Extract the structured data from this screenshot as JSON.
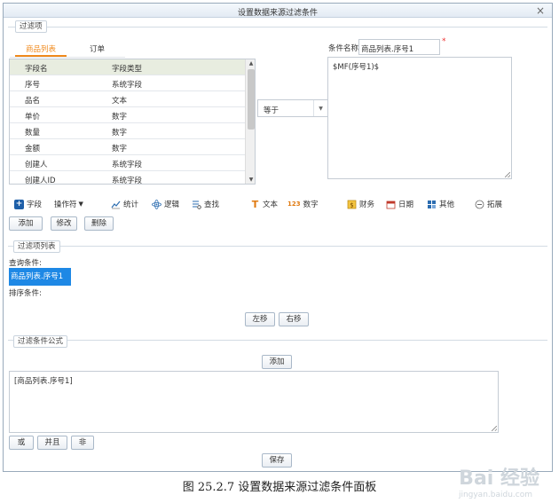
{
  "dialog": {
    "title": "设置数据来源过滤条件",
    "close_glyph": "×"
  },
  "filter_section": {
    "legend": "过滤项",
    "tabs": [
      {
        "label": "商品列表",
        "active": true
      },
      {
        "label": "订单",
        "active": false
      }
    ],
    "grid": {
      "columns": [
        "字段名",
        "字段类型"
      ],
      "rows": [
        [
          "序号",
          "系统字段"
        ],
        [
          "品名",
          "文本"
        ],
        [
          "单价",
          "数字"
        ],
        [
          "数量",
          "数字"
        ],
        [
          "金额",
          "数字"
        ],
        [
          "创建人",
          "系统字段"
        ],
        [
          "创建人ID",
          "系统字段"
        ]
      ]
    },
    "operator": {
      "selected": "等于"
    },
    "condition_name": {
      "label": "条件名称:",
      "value": "商品列表.序号1",
      "required_mark": "*"
    },
    "expression": "$MF(序号1)$"
  },
  "toolbar": {
    "items": [
      {
        "label": "字段",
        "icon": "plus-square-icon"
      },
      {
        "label": "操作符",
        "icon": "dropdown-caret-icon"
      },
      {
        "label": "统计",
        "icon": "line-chart-icon"
      },
      {
        "label": "逻辑",
        "icon": "atom-icon"
      },
      {
        "label": "查找",
        "icon": "list-search-icon"
      },
      {
        "label": "文本",
        "icon": "text-T-icon"
      },
      {
        "label": "数字",
        "icon": "number-123-icon"
      },
      {
        "label": "财务",
        "icon": "finance-icon"
      },
      {
        "label": "日期",
        "icon": "calendar-icon"
      },
      {
        "label": "其他",
        "icon": "grid-icon"
      },
      {
        "label": "拓展",
        "icon": "circle-dots-icon"
      }
    ],
    "icon_glyphs": {
      "field": "+",
      "caret": "▼",
      "text": "T",
      "number": "123"
    }
  },
  "item_buttons": {
    "add": "添加",
    "edit": "修改",
    "delete": "删除"
  },
  "list_section": {
    "legend": "过滤项列表",
    "query_label": "查询条件:",
    "selected_item": "商品列表.序号1",
    "sort_label": "排序条件:",
    "left_btn": "左移",
    "right_btn": "右移"
  },
  "formula_section": {
    "legend": "过滤条件公式",
    "add_btn": "添加",
    "formula": "[商品列表.序号1]",
    "or_btn": "或",
    "and_btn": "并且",
    "not_btn": "非",
    "save_btn": "保存"
  },
  "caption": "图 25.2.7  设置数据来源过滤条件面板",
  "watermark": {
    "text": "Bai 经验",
    "sub": "jingyan.baidu.com"
  },
  "colors": {
    "accent": "#f08a1c",
    "selection": "#1e88e5",
    "header_row": "#e8ede0"
  }
}
